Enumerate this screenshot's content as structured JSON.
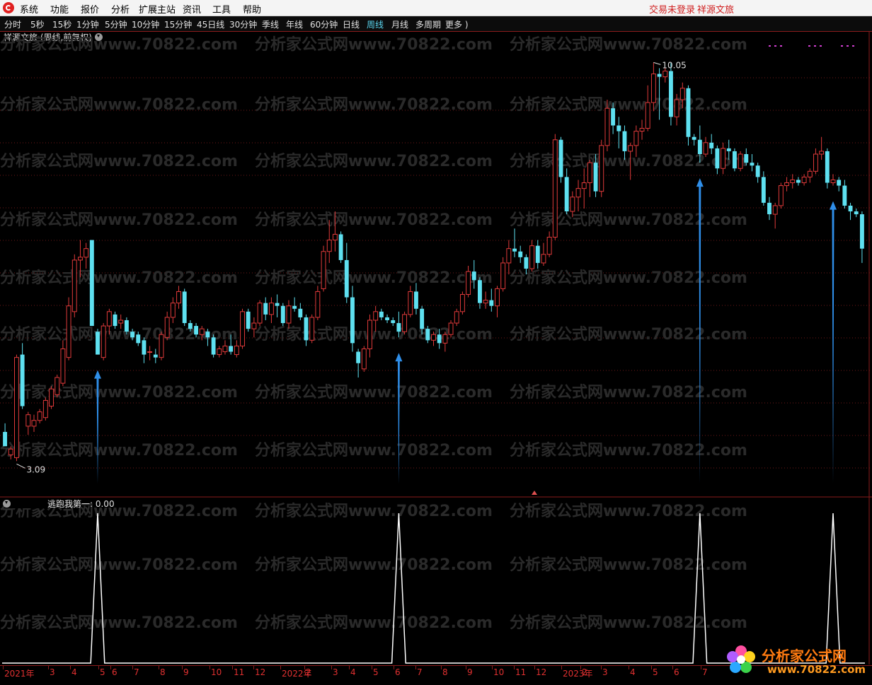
{
  "menu": {
    "items": [
      "系统",
      "功能",
      "报价",
      "分析",
      "扩展主站",
      "资讯",
      "工具",
      "帮助"
    ],
    "status_login": "交易未登录",
    "status_stock": "祥源文旅"
  },
  "periods": [
    "分时",
    "5秒",
    "15秒",
    "1分钟",
    "5分钟",
    "10分钟",
    "15分钟",
    "45日线",
    "30分钟",
    "季线",
    "年线",
    "60分钟",
    "日线",
    "周线",
    "月线",
    "多周期",
    "更多 )"
  ],
  "active_period": "周线",
  "main_chart": {
    "title": "祥源文旅 (周线,前复权)",
    "max_label": "10.05",
    "min_label": "3.09"
  },
  "indicator": {
    "title": "逃跑我第一: 0.00"
  },
  "date_axis": {
    "labels": [
      "2021年",
      "3",
      "4",
      "5",
      "6",
      "7",
      "8",
      "9",
      "10",
      "11",
      "12",
      "2022年",
      "2",
      "3",
      "4",
      "5",
      "6",
      "7",
      "8",
      "9",
      "10",
      "11",
      "12",
      "2023年",
      "2",
      "3",
      "4",
      "5",
      "6",
      "7"
    ]
  },
  "watermark": {
    "text": "分析家公式网www.70822.com",
    "logo_title": "分析家公式网",
    "logo_url": "www.70822.com"
  },
  "colors": {
    "up": "#e03a3a",
    "down": "#5ee0f0",
    "arrow": "#2f8ee8",
    "grid": "#6e1818",
    "signal": "#ffffff"
  },
  "chart_data": {
    "type": "candlestick",
    "title": "祥源文旅 (周线,前复权)",
    "period": "weekly",
    "price_range": [
      2.6,
      10.4
    ],
    "max_price": 10.05,
    "min_price": 3.09,
    "candles": [
      {
        "o": 3.6,
        "h": 3.75,
        "l": 3.35,
        "c": 3.35
      },
      {
        "o": 3.2,
        "h": 3.35,
        "l": 3.12,
        "c": 3.3
      },
      {
        "o": 3.15,
        "h": 4.95,
        "l": 3.09,
        "c": 4.9
      },
      {
        "o": 4.95,
        "h": 5.15,
        "l": 4.0,
        "c": 4.05
      },
      {
        "o": 3.7,
        "h": 3.95,
        "l": 3.55,
        "c": 3.9
      },
      {
        "o": 3.7,
        "h": 3.9,
        "l": 3.6,
        "c": 3.8
      },
      {
        "o": 3.8,
        "h": 4.0,
        "l": 3.75,
        "c": 3.95
      },
      {
        "o": 3.85,
        "h": 4.2,
        "l": 3.8,
        "c": 4.15
      },
      {
        "o": 4.05,
        "h": 4.4,
        "l": 4.0,
        "c": 4.35
      },
      {
        "o": 4.25,
        "h": 4.6,
        "l": 4.2,
        "c": 4.55
      },
      {
        "o": 4.45,
        "h": 5.2,
        "l": 4.4,
        "c": 5.05
      },
      {
        "o": 4.9,
        "h": 5.95,
        "l": 4.85,
        "c": 5.8
      },
      {
        "o": 5.7,
        "h": 6.7,
        "l": 5.6,
        "c": 6.6
      },
      {
        "o": 6.6,
        "h": 6.95,
        "l": 6.3,
        "c": 6.65
      },
      {
        "o": 6.65,
        "h": 6.9,
        "l": 6.45,
        "c": 6.8
      },
      {
        "o": 6.95,
        "h": 6.95,
        "l": 5.45,
        "c": 5.45
      },
      {
        "o": 5.35,
        "h": 5.4,
        "l": 4.95,
        "c": 4.95
      },
      {
        "o": 4.9,
        "h": 5.5,
        "l": 4.85,
        "c": 5.45
      },
      {
        "o": 5.45,
        "h": 5.75,
        "l": 5.3,
        "c": 5.7
      },
      {
        "o": 5.65,
        "h": 5.7,
        "l": 5.4,
        "c": 5.45
      },
      {
        "o": 5.5,
        "h": 5.65,
        "l": 5.4,
        "c": 5.55
      },
      {
        "o": 5.55,
        "h": 5.6,
        "l": 5.3,
        "c": 5.35
      },
      {
        "o": 5.35,
        "h": 5.4,
        "l": 5.2,
        "c": 5.25
      },
      {
        "o": 5.3,
        "h": 5.35,
        "l": 5.1,
        "c": 5.15
      },
      {
        "o": 5.2,
        "h": 5.25,
        "l": 4.8,
        "c": 4.95
      },
      {
        "o": 5.0,
        "h": 5.1,
        "l": 4.85,
        "c": 5.0
      },
      {
        "o": 4.95,
        "h": 5.05,
        "l": 4.8,
        "c": 4.9
      },
      {
        "o": 4.9,
        "h": 5.35,
        "l": 4.85,
        "c": 5.3
      },
      {
        "o": 5.25,
        "h": 5.7,
        "l": 5.2,
        "c": 5.6
      },
      {
        "o": 5.6,
        "h": 5.95,
        "l": 5.5,
        "c": 5.85
      },
      {
        "o": 5.85,
        "h": 6.15,
        "l": 5.75,
        "c": 6.05
      },
      {
        "o": 6.05,
        "h": 6.1,
        "l": 5.45,
        "c": 5.5
      },
      {
        "o": 5.5,
        "h": 5.55,
        "l": 5.35,
        "c": 5.4
      },
      {
        "o": 5.45,
        "h": 5.5,
        "l": 5.25,
        "c": 5.3
      },
      {
        "o": 5.3,
        "h": 5.45,
        "l": 5.2,
        "c": 5.4
      },
      {
        "o": 5.35,
        "h": 5.4,
        "l": 5.1,
        "c": 5.25
      },
      {
        "o": 5.25,
        "h": 5.3,
        "l": 4.9,
        "c": 4.95
      },
      {
        "o": 4.95,
        "h": 5.1,
        "l": 4.9,
        "c": 5.05
      },
      {
        "o": 5.0,
        "h": 5.2,
        "l": 4.95,
        "c": 5.1
      },
      {
        "o": 5.1,
        "h": 5.3,
        "l": 4.95,
        "c": 5.0
      },
      {
        "o": 4.95,
        "h": 5.2,
        "l": 4.9,
        "c": 5.1
      },
      {
        "o": 5.1,
        "h": 5.75,
        "l": 5.05,
        "c": 5.7
      },
      {
        "o": 5.7,
        "h": 5.75,
        "l": 5.35,
        "c": 5.4
      },
      {
        "o": 5.4,
        "h": 5.6,
        "l": 5.25,
        "c": 5.5
      },
      {
        "o": 5.5,
        "h": 5.9,
        "l": 5.45,
        "c": 5.85
      },
      {
        "o": 5.85,
        "h": 5.95,
        "l": 5.55,
        "c": 5.65
      },
      {
        "o": 5.65,
        "h": 5.95,
        "l": 5.5,
        "c": 5.85
      },
      {
        "o": 5.85,
        "h": 6.0,
        "l": 5.6,
        "c": 5.8
      },
      {
        "o": 5.8,
        "h": 5.85,
        "l": 5.45,
        "c": 5.5
      },
      {
        "o": 5.5,
        "h": 5.9,
        "l": 5.4,
        "c": 5.8
      },
      {
        "o": 5.8,
        "h": 5.95,
        "l": 5.7,
        "c": 5.75
      },
      {
        "o": 5.75,
        "h": 5.85,
        "l": 5.55,
        "c": 5.6
      },
      {
        "o": 5.6,
        "h": 5.65,
        "l": 5.1,
        "c": 5.2
      },
      {
        "o": 5.2,
        "h": 5.65,
        "l": 5.15,
        "c": 5.6
      },
      {
        "o": 5.6,
        "h": 6.15,
        "l": 5.55,
        "c": 6.05
      },
      {
        "o": 6.1,
        "h": 6.85,
        "l": 6.05,
        "c": 6.75
      },
      {
        "o": 6.75,
        "h": 7.3,
        "l": 6.55,
        "c": 6.95
      },
      {
        "o": 6.95,
        "h": 7.45,
        "l": 6.75,
        "c": 7.05
      },
      {
        "o": 7.05,
        "h": 7.1,
        "l": 6.55,
        "c": 6.6
      },
      {
        "o": 6.6,
        "h": 6.9,
        "l": 5.85,
        "c": 5.95
      },
      {
        "o": 5.95,
        "h": 6.15,
        "l": 5.0,
        "c": 5.15
      },
      {
        "o": 5.0,
        "h": 5.05,
        "l": 4.55,
        "c": 4.8
      },
      {
        "o": 4.7,
        "h": 5.1,
        "l": 4.65,
        "c": 5.05
      },
      {
        "o": 5.05,
        "h": 5.65,
        "l": 4.9,
        "c": 5.55
      },
      {
        "o": 5.55,
        "h": 5.8,
        "l": 5.35,
        "c": 5.7
      },
      {
        "o": 5.7,
        "h": 5.75,
        "l": 5.55,
        "c": 5.6
      },
      {
        "o": 5.6,
        "h": 5.65,
        "l": 5.5,
        "c": 5.55
      },
      {
        "o": 5.55,
        "h": 5.6,
        "l": 5.45,
        "c": 5.5
      },
      {
        "o": 5.5,
        "h": 5.7,
        "l": 5.25,
        "c": 5.35
      },
      {
        "o": 5.35,
        "h": 5.7,
        "l": 5.3,
        "c": 5.65
      },
      {
        "o": 5.65,
        "h": 6.15,
        "l": 5.6,
        "c": 6.05
      },
      {
        "o": 6.05,
        "h": 6.2,
        "l": 5.65,
        "c": 5.75
      },
      {
        "o": 5.75,
        "h": 5.8,
        "l": 5.3,
        "c": 5.4
      },
      {
        "o": 5.4,
        "h": 5.45,
        "l": 5.15,
        "c": 5.2
      },
      {
        "o": 5.2,
        "h": 5.35,
        "l": 5.1,
        "c": 5.3
      },
      {
        "o": 5.3,
        "h": 5.4,
        "l": 5.05,
        "c": 5.15
      },
      {
        "o": 5.15,
        "h": 5.35,
        "l": 5.0,
        "c": 5.3
      },
      {
        "o": 5.3,
        "h": 5.55,
        "l": 5.25,
        "c": 5.5
      },
      {
        "o": 5.5,
        "h": 5.75,
        "l": 5.45,
        "c": 5.7
      },
      {
        "o": 5.7,
        "h": 6.05,
        "l": 5.65,
        "c": 6.0
      },
      {
        "o": 6.0,
        "h": 6.5,
        "l": 5.95,
        "c": 6.4
      },
      {
        "o": 6.4,
        "h": 6.6,
        "l": 6.1,
        "c": 6.25
      },
      {
        "o": 6.25,
        "h": 6.3,
        "l": 5.75,
        "c": 5.85
      },
      {
        "o": 5.85,
        "h": 6.05,
        "l": 5.75,
        "c": 5.9
      },
      {
        "o": 5.9,
        "h": 6.1,
        "l": 5.7,
        "c": 5.8
      },
      {
        "o": 5.8,
        "h": 6.15,
        "l": 5.6,
        "c": 6.1
      },
      {
        "o": 6.1,
        "h": 6.65,
        "l": 6.05,
        "c": 6.55
      },
      {
        "o": 6.55,
        "h": 6.95,
        "l": 6.35,
        "c": 6.8
      },
      {
        "o": 6.8,
        "h": 7.15,
        "l": 6.65,
        "c": 6.75
      },
      {
        "o": 6.75,
        "h": 6.85,
        "l": 6.55,
        "c": 6.65
      },
      {
        "o": 6.65,
        "h": 6.7,
        "l": 6.35,
        "c": 6.45
      },
      {
        "o": 6.45,
        "h": 6.95,
        "l": 6.4,
        "c": 6.85
      },
      {
        "o": 6.85,
        "h": 6.95,
        "l": 6.45,
        "c": 6.55
      },
      {
        "o": 6.55,
        "h": 6.9,
        "l": 6.5,
        "c": 6.7
      },
      {
        "o": 6.7,
        "h": 7.1,
        "l": 6.65,
        "c": 7.0
      },
      {
        "o": 7.0,
        "h": 8.8,
        "l": 6.95,
        "c": 8.7
      },
      {
        "o": 8.7,
        "h": 8.75,
        "l": 7.95,
        "c": 8.05
      },
      {
        "o": 8.05,
        "h": 8.2,
        "l": 7.4,
        "c": 7.45
      },
      {
        "o": 7.45,
        "h": 7.8,
        "l": 7.35,
        "c": 7.7
      },
      {
        "o": 7.7,
        "h": 8.0,
        "l": 7.45,
        "c": 7.85
      },
      {
        "o": 7.85,
        "h": 8.2,
        "l": 7.5,
        "c": 7.95
      },
      {
        "o": 7.95,
        "h": 8.35,
        "l": 7.7,
        "c": 8.3
      },
      {
        "o": 8.3,
        "h": 8.45,
        "l": 7.7,
        "c": 7.8
      },
      {
        "o": 7.8,
        "h": 8.7,
        "l": 7.7,
        "c": 8.6
      },
      {
        "o": 8.6,
        "h": 9.4,
        "l": 8.5,
        "c": 9.25
      },
      {
        "o": 9.25,
        "h": 9.35,
        "l": 8.8,
        "c": 8.95
      },
      {
        "o": 8.95,
        "h": 9.1,
        "l": 8.55,
        "c": 8.85
      },
      {
        "o": 8.85,
        "h": 8.95,
        "l": 8.35,
        "c": 8.5
      },
      {
        "o": 8.5,
        "h": 8.65,
        "l": 8.0,
        "c": 8.6
      },
      {
        "o": 8.6,
        "h": 8.95,
        "l": 8.4,
        "c": 8.85
      },
      {
        "o": 8.85,
        "h": 9.05,
        "l": 8.7,
        "c": 8.9
      },
      {
        "o": 8.9,
        "h": 9.65,
        "l": 8.85,
        "c": 9.35
      },
      {
        "o": 9.35,
        "h": 10.05,
        "l": 9.2,
        "c": 9.85
      },
      {
        "o": 9.85,
        "h": 9.95,
        "l": 9.05,
        "c": 9.8
      },
      {
        "o": 9.8,
        "h": 9.95,
        "l": 9.7,
        "c": 9.9
      },
      {
        "o": 9.9,
        "h": 10.05,
        "l": 8.95,
        "c": 9.1
      },
      {
        "o": 9.1,
        "h": 9.5,
        "l": 8.95,
        "c": 9.4
      },
      {
        "o": 9.4,
        "h": 9.7,
        "l": 9.25,
        "c": 9.6
      },
      {
        "o": 9.6,
        "h": 9.65,
        "l": 8.6,
        "c": 8.75
      },
      {
        "o": 8.75,
        "h": 8.8,
        "l": 8.6,
        "c": 8.7
      },
      {
        "o": 8.7,
        "h": 8.95,
        "l": 8.3,
        "c": 8.45
      },
      {
        "o": 8.45,
        "h": 8.75,
        "l": 8.4,
        "c": 8.65
      },
      {
        "o": 8.65,
        "h": 8.8,
        "l": 8.45,
        "c": 8.55
      },
      {
        "o": 8.55,
        "h": 8.6,
        "l": 8.1,
        "c": 8.2
      },
      {
        "o": 8.2,
        "h": 8.65,
        "l": 8.1,
        "c": 8.55
      },
      {
        "o": 8.55,
        "h": 8.7,
        "l": 8.35,
        "c": 8.5
      },
      {
        "o": 8.5,
        "h": 8.55,
        "l": 8.15,
        "c": 8.2
      },
      {
        "o": 8.2,
        "h": 8.5,
        "l": 8.15,
        "c": 8.45
      },
      {
        "o": 8.45,
        "h": 8.55,
        "l": 8.25,
        "c": 8.3
      },
      {
        "o": 8.3,
        "h": 8.45,
        "l": 8.15,
        "c": 8.25
      },
      {
        "o": 8.25,
        "h": 8.3,
        "l": 7.95,
        "c": 8.05
      },
      {
        "o": 8.05,
        "h": 8.15,
        "l": 7.55,
        "c": 7.6
      },
      {
        "o": 7.6,
        "h": 7.7,
        "l": 7.3,
        "c": 7.4
      },
      {
        "o": 7.4,
        "h": 7.6,
        "l": 7.15,
        "c": 7.55
      },
      {
        "o": 7.55,
        "h": 7.95,
        "l": 7.5,
        "c": 7.9
      },
      {
        "o": 7.9,
        "h": 8.05,
        "l": 7.8,
        "c": 7.95
      },
      {
        "o": 7.95,
        "h": 8.1,
        "l": 7.85,
        "c": 8.0
      },
      {
        "o": 8.0,
        "h": 8.05,
        "l": 7.9,
        "c": 7.95
      },
      {
        "o": 7.95,
        "h": 8.1,
        "l": 7.9,
        "c": 8.05
      },
      {
        "o": 8.05,
        "h": 8.2,
        "l": 7.95,
        "c": 8.15
      },
      {
        "o": 8.15,
        "h": 8.55,
        "l": 8.1,
        "c": 8.45
      },
      {
        "o": 8.45,
        "h": 8.75,
        "l": 8.35,
        "c": 8.5
      },
      {
        "o": 8.5,
        "h": 8.55,
        "l": 7.85,
        "c": 7.95
      },
      {
        "o": 7.95,
        "h": 8.1,
        "l": 7.9,
        "c": 8.0
      },
      {
        "o": 8.0,
        "h": 8.05,
        "l": 7.8,
        "c": 7.9
      },
      {
        "o": 7.9,
        "h": 8.0,
        "l": 7.5,
        "c": 7.55
      },
      {
        "o": 7.55,
        "h": 7.6,
        "l": 7.3,
        "c": 7.45
      },
      {
        "o": 7.45,
        "h": 7.5,
        "l": 7.35,
        "c": 7.4
      },
      {
        "o": 7.4,
        "h": 7.45,
        "l": 6.55,
        "c": 6.8
      }
    ],
    "signal_indices": [
      16,
      68,
      120,
      143
    ],
    "indicator_series": {
      "name": "逃跑我第一",
      "last_value": 0.0,
      "pulse_value": 1
    }
  }
}
